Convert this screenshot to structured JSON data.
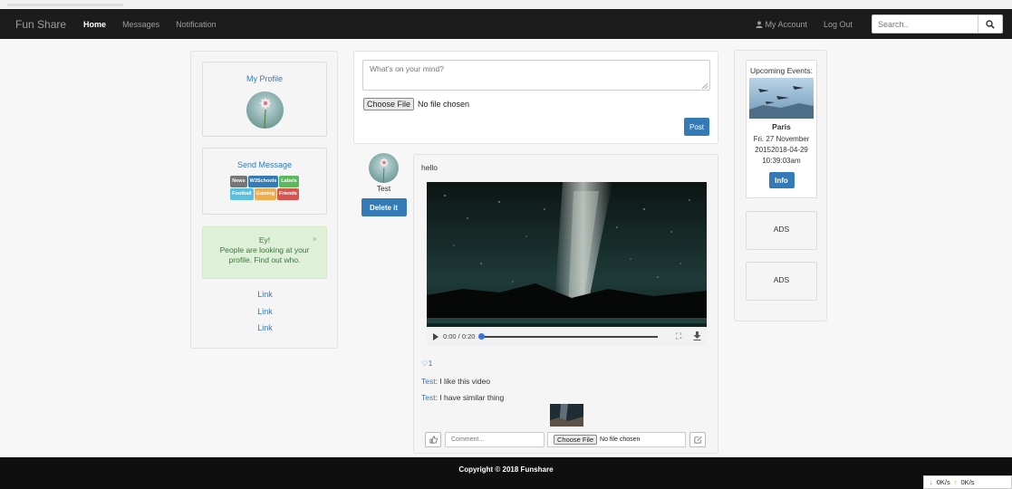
{
  "navbar": {
    "brand": "Fun Share",
    "links": [
      "Home",
      "Messages",
      "Notification"
    ],
    "account": "My Account",
    "logout": "Log Out",
    "search_placeholder": "Search.."
  },
  "left": {
    "profile_title": "My Profile",
    "message_title": "Send Message",
    "labels": [
      {
        "text": "News",
        "color": "#777777"
      },
      {
        "text": "W3Schools",
        "color": "#337ab7"
      },
      {
        "text": "Labels",
        "color": "#5cb85c"
      },
      {
        "text": "Football",
        "color": "#5bc0de"
      },
      {
        "text": "Gaming",
        "color": "#f0ad4e"
      },
      {
        "text": "Friends",
        "color": "#d9534f"
      }
    ],
    "alert_title": "Ey!",
    "alert_text": "People are looking at your profile. Find out who.",
    "alert_close": "×",
    "links": [
      "Link",
      "Link",
      "Link"
    ]
  },
  "composer": {
    "placeholder": "What's on your mind?",
    "file_button": "Choose File",
    "file_status": "No file chosen",
    "post_button": "Post"
  },
  "post": {
    "author": "Test",
    "delete_button": "Delete it",
    "text": "hello",
    "video_time": "0:00 / 0:20",
    "video_progress": 0.0,
    "likes": "1",
    "comments": [
      {
        "author": "Test",
        "text": "I like this video"
      },
      {
        "author": "Test",
        "text": "I have similar thing"
      }
    ],
    "comment_placeholder": "Comment...",
    "file_button": "Choose File",
    "file_status": "No file chosen"
  },
  "right": {
    "events_title": "Upcoming Events:",
    "event_place": "Paris",
    "event_date": "Fri. 27 November 20152018-04-29 10:39:03am",
    "info_button": "Info",
    "ads": [
      "ADS",
      "ADS"
    ]
  },
  "footer": {
    "copyright": "Copyright © 2018 Funshare"
  },
  "speed": {
    "down": "0K/s",
    "up": "0K/s"
  },
  "colors": {
    "navbar": "#1c1c1c",
    "primary": "#337ab7",
    "alert_bg": "#dff0d8",
    "alert_text": "#3c763d",
    "footer": "#0f0f0f"
  }
}
